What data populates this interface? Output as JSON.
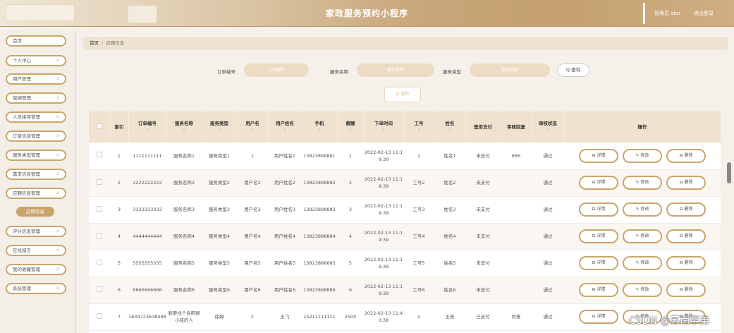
{
  "header": {
    "title": "家政服务预约小程序",
    "user_label": "管理员 abo",
    "logout_label": "退出登录"
  },
  "sidebar": {
    "items": [
      {
        "label": "首页",
        "has_chevron": false
      },
      {
        "label": "个人中心",
        "has_chevron": true
      },
      {
        "label": "用户管理",
        "has_chevron": true
      },
      {
        "label": "保姆管理",
        "has_chevron": true
      },
      {
        "label": "人员排序管理",
        "has_chevron": true
      },
      {
        "label": "订单信息管理",
        "has_chevron": true
      },
      {
        "label": "服务类型管理",
        "has_chevron": true
      },
      {
        "label": "需求信息管理",
        "has_chevron": true
      },
      {
        "label": "应聘信息管理",
        "has_chevron": true
      },
      {
        "label": "评分信息管理",
        "has_chevron": true
      },
      {
        "label": "在线留言",
        "has_chevron": true
      },
      {
        "label": "我的收藏管理",
        "has_chevron": true
      },
      {
        "label": "系统管理",
        "has_chevron": true
      }
    ],
    "active_sub": "应聘信息"
  },
  "breadcrumb": {
    "home": "首页",
    "separator": "/",
    "current": "应聘信息"
  },
  "filters": {
    "order_label": "订单编号",
    "order_placeholder": "订单编号",
    "service_label": "服务名称",
    "service_placeholder": "服务名称",
    "type_label": "服务类型",
    "type_placeholder": "服务类型",
    "search_label": "Q 查询"
  },
  "delete_batch_label": "⊟ 删除",
  "table": {
    "headers": [
      "",
      "索引",
      "订单编号",
      "服务名称",
      "服务类型",
      "用户名",
      "用户姓名",
      "手机",
      "薪酬",
      "下单时间",
      "工号",
      "姓名",
      "是否支付",
      "审核回复",
      "审核状态",
      "操作"
    ],
    "rows": [
      [
        "",
        "1",
        "1111111111",
        "服务名称1",
        "服务类型1",
        "1",
        "用户姓名1",
        "13823888881",
        "1",
        "2022-02-13 11:19:39",
        "1",
        "姓名1",
        "未支付",
        "666",
        "通过"
      ],
      [
        "",
        "2",
        "2222222222",
        "服务名称2",
        "服务类型2",
        "用户名2",
        "用户姓名2",
        "13823888882",
        "2",
        "2022-02-13 11:19:39",
        "工号2",
        "姓名2",
        "未支付",
        "",
        "通过"
      ],
      [
        "",
        "3",
        "3333333333",
        "服务名称3",
        "服务类型3",
        "用户名3",
        "用户姓名3",
        "13823888883",
        "3",
        "2022-02-13 11:19:39",
        "工号3",
        "姓名3",
        "未支付",
        "",
        "通过"
      ],
      [
        "",
        "4",
        "4444444444",
        "服务名称4",
        "服务类型4",
        "用户名4",
        "用户姓名4",
        "13823888884",
        "4",
        "2022-02-13 11:19:39",
        "工号4",
        "姓名4",
        "未支付",
        "",
        "通过"
      ],
      [
        "",
        "5",
        "5555555555",
        "服务名称5",
        "服务类型5",
        "用户名5",
        "用户姓名5",
        "13823888885",
        "5",
        "2022-02-13 11:19:39",
        "工号5",
        "姓名5",
        "未支付",
        "",
        "通过"
      ],
      [
        "",
        "6",
        "6666666666",
        "服务名称6",
        "服务类型6",
        "用户名6",
        "用户姓名6",
        "13823888886",
        "6",
        "2022-02-13 11:19:39",
        "工号6",
        "姓名6",
        "未支付",
        "",
        "通过"
      ],
      [
        "",
        "7",
        "1644723638488",
        "我要找个会照顾小孩的人",
        "保姆",
        "2",
        "王飞",
        "15211111111",
        "2500",
        "2022-02-13 11:40:38",
        "2",
        "王燕",
        "已支付",
        "同意",
        "通过"
      ]
    ],
    "actions": {
      "detail": "⊟ 详情",
      "edit": "✎ 修改",
      "delete": "⊟ 删除"
    }
  },
  "watermark": "CSDN @苏南学弟"
}
